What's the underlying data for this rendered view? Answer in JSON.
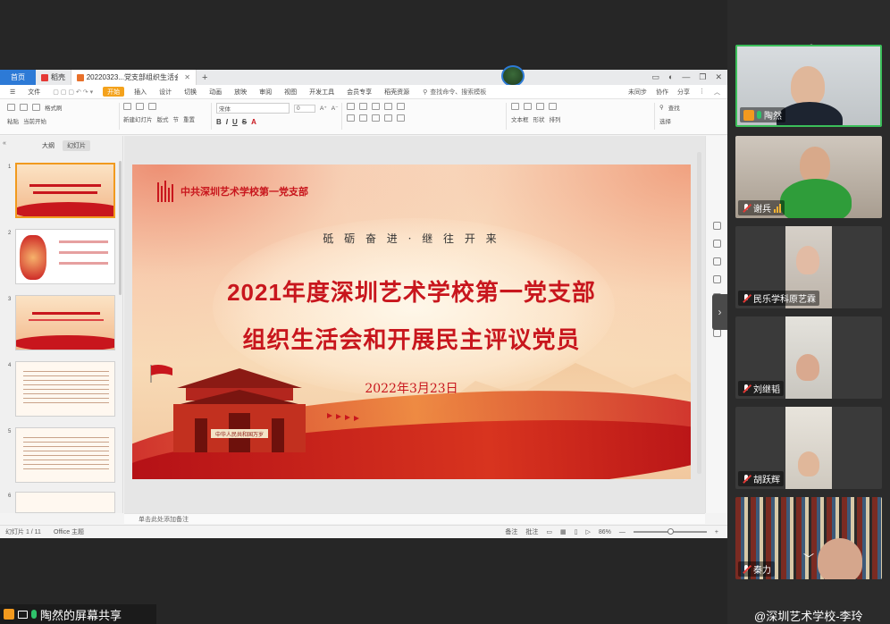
{
  "wps": {
    "tabs": [
      {
        "label": "首页"
      },
      {
        "label": "稻壳"
      },
      {
        "label": "20220323...党支部组织生活会"
      }
    ],
    "menu": {
      "file": "文件",
      "items": [
        "开始",
        "插入",
        "设计",
        "切换",
        "动画",
        "放映",
        "审阅",
        "视图",
        "开发工具",
        "会员专享",
        "稻壳资源"
      ],
      "search": "查找命令、搜索模板",
      "right": [
        "未同步",
        "协作",
        "分享"
      ]
    },
    "ribbon": {
      "row1": [
        "格式刷",
        "粘贴",
        "当前开始",
        "新建幻灯片",
        "版式",
        "节",
        "重置",
        "文本框",
        "形状",
        "排列",
        "查找",
        "选择"
      ],
      "font_name": "宋体",
      "font_size": "0"
    },
    "thumbpane": {
      "tab_outline": "大纲",
      "tab_slides": "幻灯片",
      "numbers": [
        "1",
        "2",
        "3",
        "4",
        "5",
        "6"
      ]
    },
    "slide": {
      "org": "中共深圳艺术学校第一党支部",
      "motto": "砥 砺 奋 进   ·   继 往 开 来",
      "title1": "2021年度深圳艺术学校第一党支部",
      "title2": "组织生活会和开展民主评议党员",
      "date": "2022年3月23日",
      "gate_sign": "中华人民共和国万岁"
    },
    "notes_placeholder": "单击此处添加备注",
    "status": {
      "slide_counter": "幻灯片 1 / 11",
      "theme": "Office 主题",
      "notes": "备注",
      "comments": "批注",
      "zoom": "86%"
    }
  },
  "share_label": "陶然的屏幕共享",
  "participants": [
    {
      "name": "陶然",
      "state": "speaking"
    },
    {
      "name": "谢兵",
      "state": "muted"
    },
    {
      "name": "民乐学科原艺霖",
      "state": "muted"
    },
    {
      "name": "刘继韬",
      "state": "muted"
    },
    {
      "name": "胡跃辉",
      "state": "muted"
    },
    {
      "name": "秦力",
      "state": "muted"
    }
  ],
  "watermark": "@深圳艺术学校-李玲",
  "colors": {
    "accent": "#f4a21c",
    "slide_red": "#c8161d",
    "active_tile": "#3bbf5a"
  }
}
